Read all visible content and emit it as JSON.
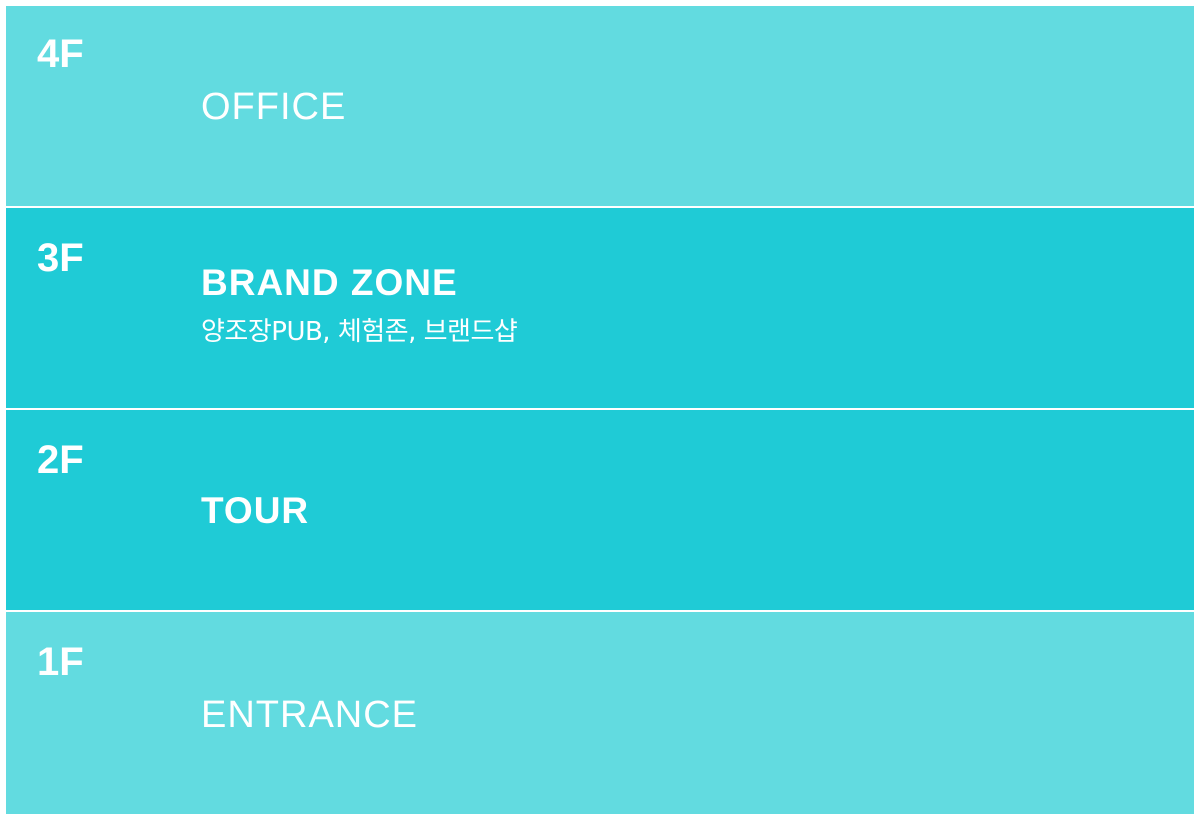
{
  "floors": [
    {
      "level": "4F",
      "title": "OFFICE",
      "subtitle": ""
    },
    {
      "level": "3F",
      "title": "BRAND ZONE",
      "subtitle": "양조장PUB, 체험존, 브랜드샵"
    },
    {
      "level": "2F",
      "title": "TOUR",
      "subtitle": ""
    },
    {
      "level": "1F",
      "title": "ENTRANCE",
      "subtitle": ""
    }
  ],
  "colors": {
    "light_band": "#62dbe0",
    "dark_band": "#1fcbd6",
    "text": "#ffffff"
  }
}
